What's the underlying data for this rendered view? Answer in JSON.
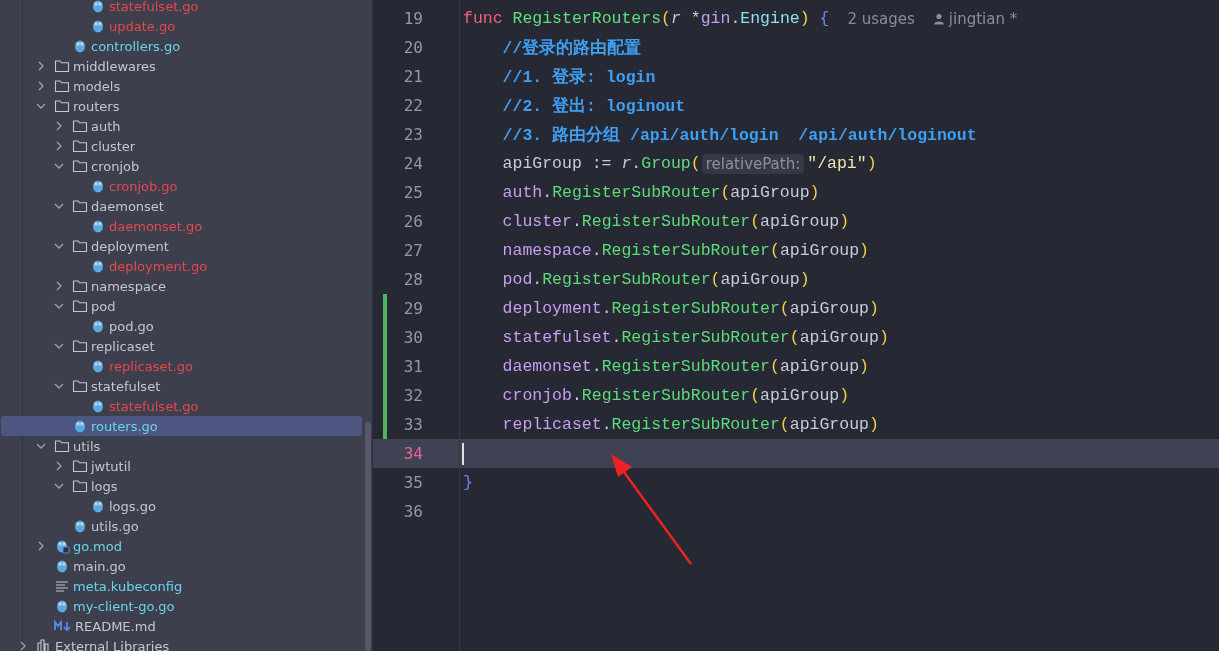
{
  "project_tree": [
    {
      "kind": "hidden",
      "children": [
        {
          "kind": "hidden",
          "children": [
            {
              "kind": "hidden",
              "children": [
                {
                  "label": "statefulset.go",
                  "kind": "go",
                  "color": "#e5484d",
                  "selected": false
                },
                {
                  "label": "update.go",
                  "kind": "go",
                  "color": "#e5484d",
                  "selected": false
                }
              ]
            },
            {
              "label": "controllers.go",
              "kind": "go",
              "color": "#6ad4ec",
              "selected": false
            }
          ]
        },
        {
          "label": "middlewares",
          "kind": "folder",
          "expanded": false,
          "color": "#c4c7cf",
          "selected": false
        },
        {
          "label": "models",
          "kind": "folder",
          "expanded": false,
          "color": "#c4c7cf",
          "selected": false
        },
        {
          "label": "routers",
          "kind": "folder",
          "expanded": true,
          "color": "#c4c7cf",
          "selected": false,
          "children": [
            {
              "label": "auth",
              "kind": "folder",
              "expanded": false,
              "color": "#c4c7cf",
              "selected": false
            },
            {
              "label": "cluster",
              "kind": "folder",
              "expanded": false,
              "color": "#c4c7cf",
              "selected": false
            },
            {
              "label": "cronjob",
              "kind": "folder",
              "expanded": true,
              "color": "#c4c7cf",
              "selected": false,
              "children": [
                {
                  "label": "cronjob.go",
                  "kind": "go",
                  "color": "#e5484d",
                  "selected": false
                }
              ]
            },
            {
              "label": "daemonset",
              "kind": "folder",
              "expanded": true,
              "color": "#c4c7cf",
              "selected": false,
              "children": [
                {
                  "label": "daemonset.go",
                  "kind": "go",
                  "color": "#e5484d",
                  "selected": false
                }
              ]
            },
            {
              "label": "deployment",
              "kind": "folder",
              "expanded": true,
              "color": "#c4c7cf",
              "selected": false,
              "children": [
                {
                  "label": "deployment.go",
                  "kind": "go",
                  "color": "#e5484d",
                  "selected": false
                }
              ]
            },
            {
              "label": "namespace",
              "kind": "folder",
              "expanded": false,
              "color": "#c4c7cf",
              "selected": false
            },
            {
              "label": "pod",
              "kind": "folder",
              "expanded": true,
              "color": "#c4c7cf",
              "selected": false,
              "children": [
                {
                  "label": "pod.go",
                  "kind": "go",
                  "color": "#c4c7cf",
                  "selected": false
                }
              ]
            },
            {
              "label": "replicaset",
              "kind": "folder",
              "expanded": true,
              "color": "#c4c7cf",
              "selected": false,
              "children": [
                {
                  "label": "replicaset.go",
                  "kind": "go",
                  "color": "#e5484d",
                  "selected": false
                }
              ]
            },
            {
              "label": "statefulset",
              "kind": "folder",
              "expanded": true,
              "color": "#c4c7cf",
              "selected": false,
              "children": [
                {
                  "label": "statefulset.go",
                  "kind": "go",
                  "color": "#e5484d",
                  "selected": false
                }
              ]
            },
            {
              "label": "routers.go",
              "kind": "go",
              "color": "#6ad4ec",
              "selected": true
            }
          ]
        },
        {
          "label": "utils",
          "kind": "folder",
          "expanded": true,
          "color": "#c4c7cf",
          "selected": false,
          "children": [
            {
              "label": "jwtutil",
              "kind": "folder",
              "expanded": false,
              "color": "#c4c7cf",
              "selected": false
            },
            {
              "label": "logs",
              "kind": "folder",
              "expanded": true,
              "color": "#c4c7cf",
              "selected": false,
              "children": [
                {
                  "label": "logs.go",
                  "kind": "go",
                  "color": "#c4c7cf",
                  "selected": false
                }
              ]
            },
            {
              "label": "utils.go",
              "kind": "go",
              "color": "#c4c7cf",
              "selected": false
            }
          ]
        },
        {
          "label": "go.mod",
          "kind": "gomod",
          "expanded": false,
          "color": "#6ad4ec",
          "selected": false
        },
        {
          "label": "main.go",
          "kind": "go",
          "color": "#c4c7cf",
          "selected": false
        },
        {
          "label": "meta.kubeconfig",
          "kind": "text",
          "color": "#6ad4ec",
          "selected": false
        },
        {
          "label": "my-client-go.go",
          "kind": "go",
          "color": "#6ad4ec",
          "selected": false
        },
        {
          "label": "README.md",
          "kind": "markdown",
          "color": "#c4c7cf",
          "selected": false
        }
      ]
    },
    {
      "label": "External Libraries",
      "kind": "library",
      "expanded": false,
      "color": "#c4c7cf",
      "selected": false
    }
  ],
  "editor": {
    "lines": [
      {
        "number": "19",
        "changed": false,
        "current": false,
        "tokens": [
          {
            "text": "func ",
            "kind": "keyword"
          },
          {
            "text": "RegisterRouters",
            "kind": "func"
          },
          {
            "text": "(",
            "kind": "paren"
          },
          {
            "text": "r",
            "kind": "param"
          },
          {
            "text": " *",
            "kind": "plain"
          },
          {
            "text": "gin",
            "kind": "pkg"
          },
          {
            "text": ".",
            "kind": "plain"
          },
          {
            "text": "Engine",
            "kind": "type"
          },
          {
            "text": ") ",
            "kind": "paren"
          },
          {
            "text": "{",
            "kind": "brace"
          }
        ],
        "usages": "2 usages",
        "author": "jingtian *"
      },
      {
        "number": "20",
        "changed": false,
        "current": false,
        "tokens": [
          {
            "text": "    //登录的路由配置",
            "kind": "comment"
          }
        ]
      },
      {
        "number": "21",
        "changed": false,
        "current": false,
        "tokens": [
          {
            "text": "    //1. 登录: login",
            "kind": "comment"
          }
        ]
      },
      {
        "number": "22",
        "changed": false,
        "current": false,
        "tokens": [
          {
            "text": "    //2. 登出: loginout",
            "kind": "comment"
          }
        ]
      },
      {
        "number": "23",
        "changed": false,
        "current": false,
        "tokens": [
          {
            "text": "    //3. 路由分组 /api/auth/login  /api/auth/loginout",
            "kind": "comment"
          }
        ]
      },
      {
        "number": "24",
        "changed": false,
        "current": false,
        "tokens": [
          {
            "text": "    apiGroup := ",
            "kind": "plain"
          },
          {
            "text": "r",
            "kind": "param"
          },
          {
            "text": ".",
            "kind": "plain"
          },
          {
            "text": "Group",
            "kind": "method"
          },
          {
            "text": "(",
            "kind": "paren"
          },
          {
            "text": "relativePath:",
            "kind": "hint"
          },
          {
            "text": "\"/api\"",
            "kind": "string"
          },
          {
            "text": ")",
            "kind": "paren"
          }
        ]
      },
      {
        "number": "25",
        "changed": false,
        "current": false,
        "tokens": [
          {
            "text": "    auth",
            "kind": "pkg"
          },
          {
            "text": ".",
            "kind": "plain"
          },
          {
            "text": "RegisterSubRouter",
            "kind": "method"
          },
          {
            "text": "(",
            "kind": "paren"
          },
          {
            "text": "apiGroup",
            "kind": "plain"
          },
          {
            "text": ")",
            "kind": "paren"
          }
        ]
      },
      {
        "number": "26",
        "changed": false,
        "current": false,
        "tokens": [
          {
            "text": "    cluster",
            "kind": "pkg"
          },
          {
            "text": ".",
            "kind": "plain"
          },
          {
            "text": "RegisterSubRouter",
            "kind": "method"
          },
          {
            "text": "(",
            "kind": "paren"
          },
          {
            "text": "apiGroup",
            "kind": "plain"
          },
          {
            "text": ")",
            "kind": "paren"
          }
        ]
      },
      {
        "number": "27",
        "changed": false,
        "current": false,
        "tokens": [
          {
            "text": "    namespace",
            "kind": "pkg"
          },
          {
            "text": ".",
            "kind": "plain"
          },
          {
            "text": "RegisterSubRouter",
            "kind": "method"
          },
          {
            "text": "(",
            "kind": "paren"
          },
          {
            "text": "apiGroup",
            "kind": "plain"
          },
          {
            "text": ")",
            "kind": "paren"
          }
        ]
      },
      {
        "number": "28",
        "changed": false,
        "current": false,
        "tokens": [
          {
            "text": "    pod",
            "kind": "pkg"
          },
          {
            "text": ".",
            "kind": "plain"
          },
          {
            "text": "RegisterSubRouter",
            "kind": "method"
          },
          {
            "text": "(",
            "kind": "paren"
          },
          {
            "text": "apiGroup",
            "kind": "plain"
          },
          {
            "text": ")",
            "kind": "paren"
          }
        ]
      },
      {
        "number": "29",
        "changed": true,
        "current": false,
        "tokens": [
          {
            "text": "    deployment",
            "kind": "pkg"
          },
          {
            "text": ".",
            "kind": "plain"
          },
          {
            "text": "RegisterSubRouter",
            "kind": "method"
          },
          {
            "text": "(",
            "kind": "paren"
          },
          {
            "text": "apiGroup",
            "kind": "plain"
          },
          {
            "text": ")",
            "kind": "paren"
          }
        ]
      },
      {
        "number": "30",
        "changed": true,
        "current": false,
        "tokens": [
          {
            "text": "    statefulset",
            "kind": "pkg"
          },
          {
            "text": ".",
            "kind": "plain"
          },
          {
            "text": "RegisterSubRouter",
            "kind": "method"
          },
          {
            "text": "(",
            "kind": "paren"
          },
          {
            "text": "apiGroup",
            "kind": "plain"
          },
          {
            "text": ")",
            "kind": "paren"
          }
        ]
      },
      {
        "number": "31",
        "changed": true,
        "current": false,
        "tokens": [
          {
            "text": "    daemonset",
            "kind": "pkg"
          },
          {
            "text": ".",
            "kind": "plain"
          },
          {
            "text": "RegisterSubRouter",
            "kind": "method"
          },
          {
            "text": "(",
            "kind": "paren"
          },
          {
            "text": "apiGroup",
            "kind": "plain"
          },
          {
            "text": ")",
            "kind": "paren"
          }
        ]
      },
      {
        "number": "32",
        "changed": true,
        "current": false,
        "tokens": [
          {
            "text": "    cronjob",
            "kind": "pkg"
          },
          {
            "text": ".",
            "kind": "plain"
          },
          {
            "text": "RegisterSubRouter",
            "kind": "method"
          },
          {
            "text": "(",
            "kind": "paren"
          },
          {
            "text": "apiGroup",
            "kind": "plain"
          },
          {
            "text": ")",
            "kind": "paren"
          }
        ]
      },
      {
        "number": "33",
        "changed": true,
        "current": false,
        "tokens": [
          {
            "text": "    replicaset",
            "kind": "pkg"
          },
          {
            "text": ".",
            "kind": "plain"
          },
          {
            "text": "RegisterSubRouter",
            "kind": "method"
          },
          {
            "text": "(",
            "kind": "paren"
          },
          {
            "text": "apiGroup",
            "kind": "plain"
          },
          {
            "text": ")",
            "kind": "paren"
          }
        ]
      },
      {
        "number": "34",
        "changed": false,
        "current": true
      },
      {
        "number": "35",
        "changed": false,
        "current": false,
        "tokens": [
          {
            "text": "}",
            "kind": "brace"
          }
        ]
      },
      {
        "number": "36",
        "changed": false,
        "current": false
      }
    ]
  }
}
